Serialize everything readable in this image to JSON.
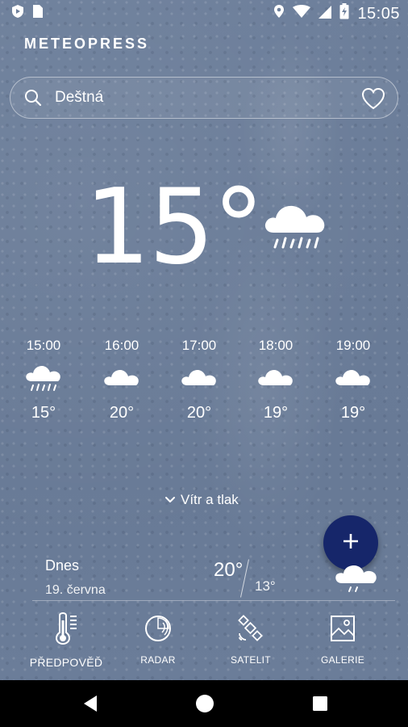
{
  "status_bar": {
    "time": "15:05",
    "icons": [
      "shield-icon",
      "sim-card-icon",
      "location-icon",
      "wifi-icon",
      "signal-icon",
      "battery-charging-icon"
    ]
  },
  "app": {
    "brand": "METEOPRESS"
  },
  "search": {
    "location": "Deštná",
    "icon": "search-icon",
    "favorite_icon": "heart-icon"
  },
  "current": {
    "temperature": "15°",
    "icon": "cloud-rain-icon"
  },
  "hourly": [
    {
      "time": "15:00",
      "temp": "15°",
      "icon": "cloud-rain-icon"
    },
    {
      "time": "16:00",
      "temp": "20°",
      "icon": "cloud-icon"
    },
    {
      "time": "17:00",
      "temp": "20°",
      "icon": "cloud-icon"
    },
    {
      "time": "18:00",
      "temp": "19°",
      "icon": "cloud-icon"
    },
    {
      "time": "19:00",
      "temp": "19°",
      "icon": "cloud-icon"
    }
  ],
  "wind_link": {
    "label": "Vítr a tlak",
    "icon": "chevron-down-icon"
  },
  "fab": {
    "icon": "plus-icon",
    "color": "#16266a"
  },
  "daily": {
    "day": "Dnes",
    "date": "19. června",
    "max": "20°",
    "min": "13°",
    "icon": "cloud-rain-icon"
  },
  "bottom_nav": {
    "items": [
      {
        "label": "PŘEDPOVĚĎ",
        "icon": "thermometer-icon",
        "active": true
      },
      {
        "label": "RADAR",
        "icon": "radar-icon",
        "active": false
      },
      {
        "label": "SATELIT",
        "icon": "satellite-icon",
        "active": false
      },
      {
        "label": "GALERIE",
        "icon": "gallery-icon",
        "active": false
      }
    ]
  },
  "android_nav": {
    "icons": [
      "back-icon",
      "home-icon",
      "recent-apps-icon"
    ]
  }
}
